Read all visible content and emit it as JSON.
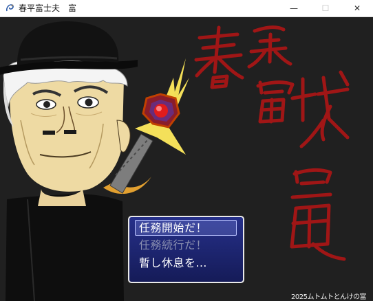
{
  "window": {
    "title": "春平富士夫　富",
    "app_icon": "rpg-maker-icon",
    "controls": {
      "minimize": "—",
      "maximize": "☐",
      "close": "✕"
    }
  },
  "game": {
    "title_calligraphy_icon": "title-calligraphy",
    "menu": {
      "items": [
        {
          "label": "任務開始だ！",
          "state": "selected"
        },
        {
          "label": "任務続行だ！",
          "state": "disabled"
        },
        {
          "label": "暫し休息を…",
          "state": "enabled"
        }
      ]
    },
    "credit": "2025ムトムトとんけの富"
  },
  "colors": {
    "background": "#202020",
    "calligraphy": "#a01616",
    "menu_top": "#26308a",
    "menu_bottom": "#151b58",
    "disabled_text": "#8a8fb0"
  }
}
